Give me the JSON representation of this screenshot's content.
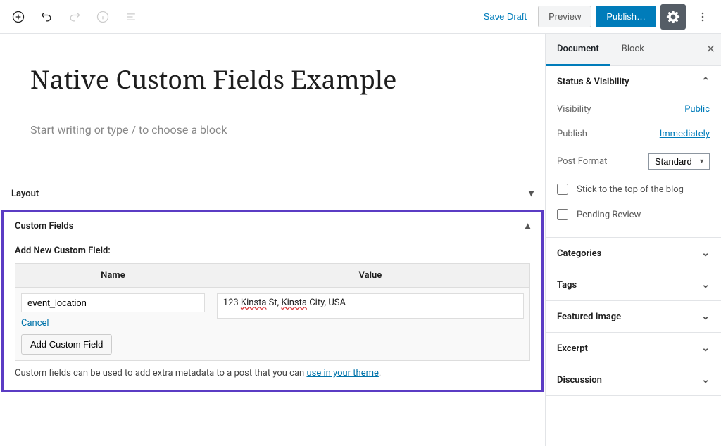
{
  "topbar": {
    "save_draft": "Save Draft",
    "preview": "Preview",
    "publish": "Publish…"
  },
  "editor": {
    "title": "Native Custom Fields Example",
    "body_placeholder": "Start writing or type / to choose a block"
  },
  "metaboxes": {
    "layout": {
      "title": "Layout"
    },
    "custom_fields": {
      "title": "Custom Fields",
      "add_new_heading": "Add New Custom Field:",
      "name_header": "Name",
      "value_header": "Value",
      "name_value": "event_location",
      "value_value_prefix": "123 ",
      "value_value_k1": "Kinsta",
      "value_value_mid": " St, ",
      "value_value_k2": "Kinsta",
      "value_value_suffix": " City, USA",
      "cancel": "Cancel",
      "add_btn": "Add Custom Field",
      "hint_prefix": "Custom fields can be used to add extra metadata to a post that you can ",
      "hint_link": "use in your theme",
      "hint_suffix": "."
    }
  },
  "sidebar": {
    "tabs": {
      "document": "Document",
      "block": "Block"
    },
    "status": {
      "heading": "Status & Visibility",
      "visibility_label": "Visibility",
      "visibility_value": "Public",
      "publish_label": "Publish",
      "publish_value": "Immediately",
      "post_format_label": "Post Format",
      "post_format_value": "Standard",
      "stick_label": "Stick to the top of the blog",
      "pending_label": "Pending Review"
    },
    "panels": {
      "categories": "Categories",
      "tags": "Tags",
      "featured_image": "Featured Image",
      "excerpt": "Excerpt",
      "discussion": "Discussion"
    }
  }
}
